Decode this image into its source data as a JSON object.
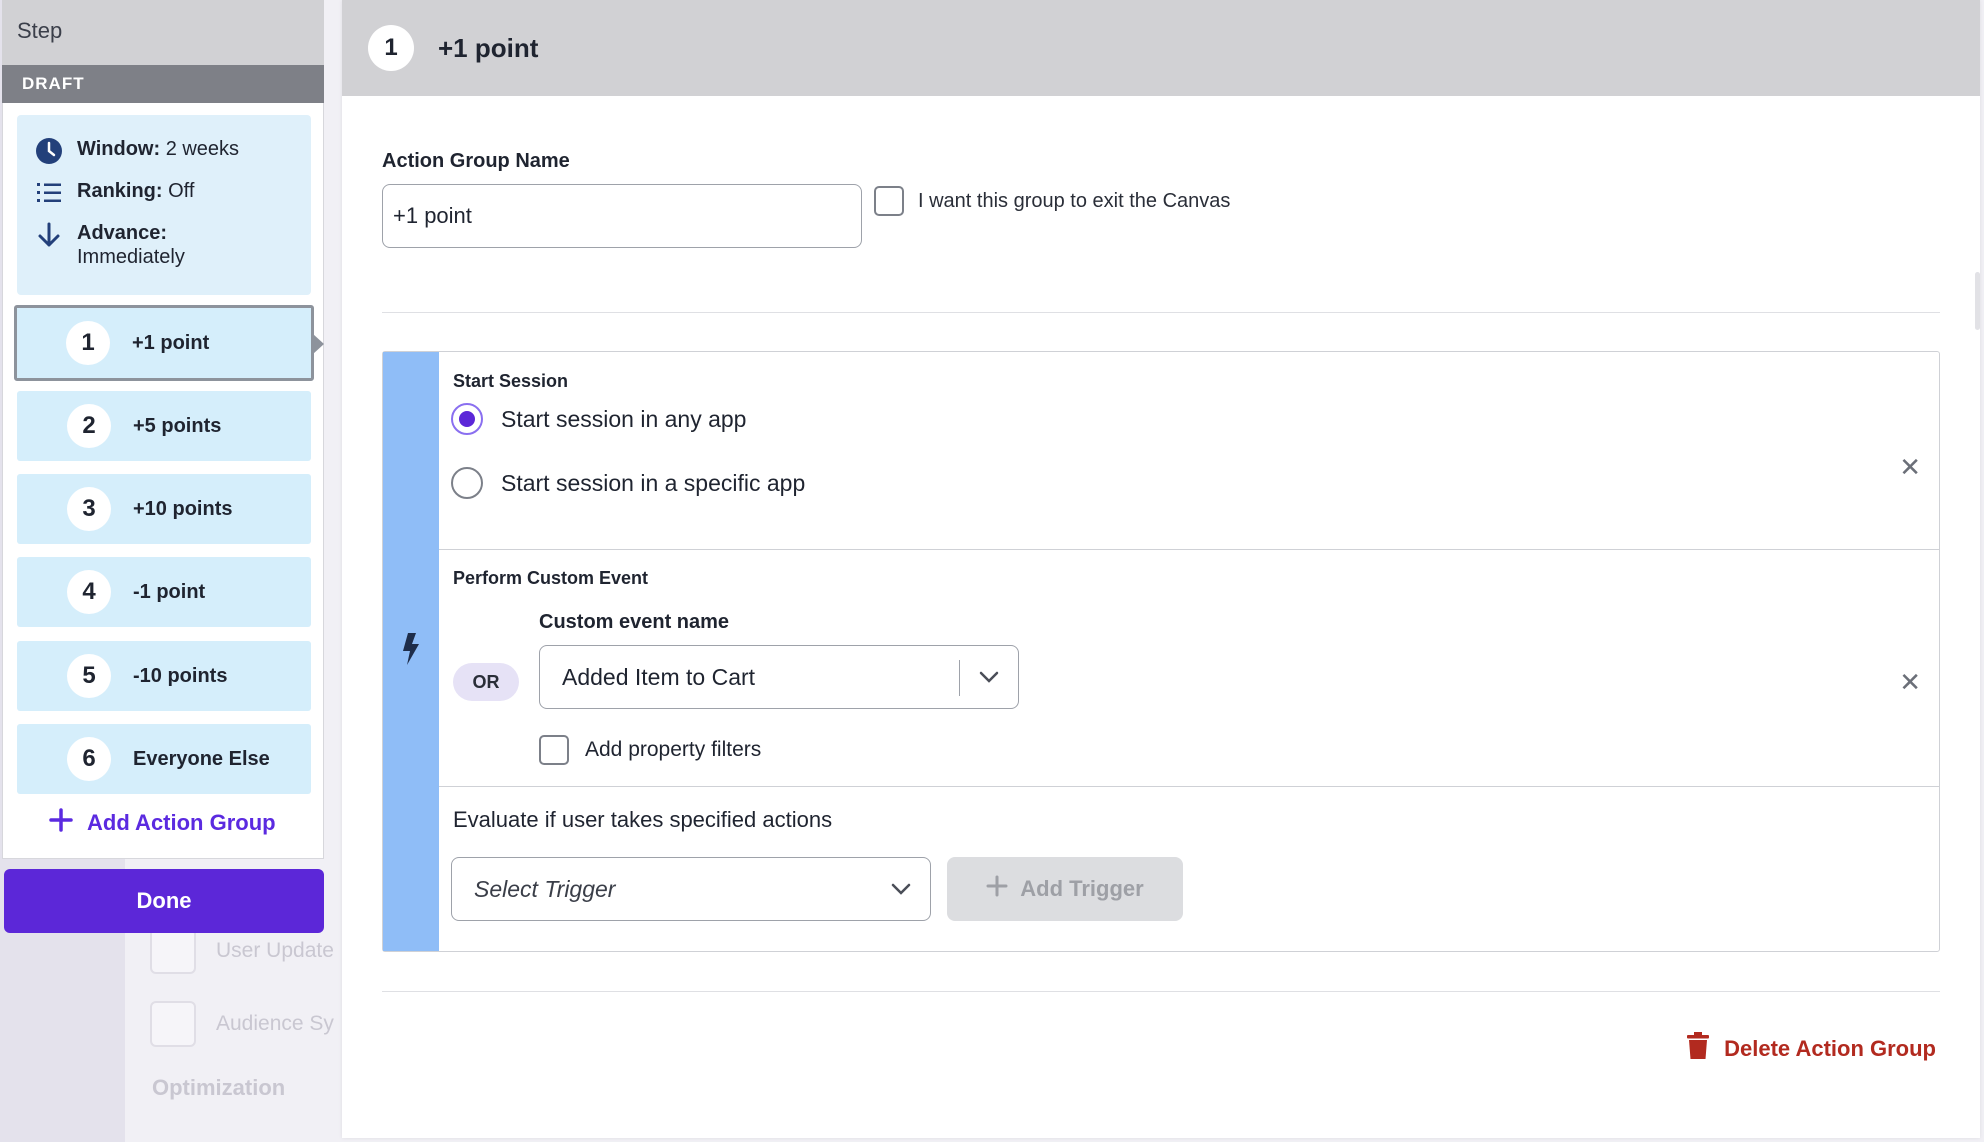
{
  "colors": {
    "accent": "#5c27d8",
    "stripe": "#8fbdf7",
    "group_bg": "#d5eefb",
    "danger": "#b22a1f",
    "header_gray": "#d1d1d4"
  },
  "background": {
    "items": [
      {
        "label": "User Update",
        "icon": "user-update-icon"
      },
      {
        "label": "Audience Sy",
        "icon": "audience-sync-icon"
      }
    ],
    "heading": "Optimization"
  },
  "sidebar": {
    "title": "Step",
    "status": "DRAFT",
    "summary": {
      "window_label": "Window:",
      "window_value": "2 weeks",
      "ranking_label": "Ranking:",
      "ranking_value": "Off",
      "advance_label": "Advance:",
      "advance_value": "Immediately"
    },
    "groups": [
      {
        "number": "1",
        "label": "+1 point"
      },
      {
        "number": "2",
        "label": "+5 points"
      },
      {
        "number": "3",
        "label": "+10 points"
      },
      {
        "number": "4",
        "label": "-1 point"
      },
      {
        "number": "5",
        "label": "-10 points"
      },
      {
        "number": "6",
        "label": "Everyone Else"
      }
    ],
    "add_group_label": "Add Action Group",
    "done_label": "Done"
  },
  "main": {
    "header": {
      "number": "1",
      "title": "+1 point"
    },
    "name_label": "Action Group Name",
    "name_value": "+1 point",
    "exit_label": "I want this group to exit the Canvas",
    "start_session": {
      "title": "Start Session",
      "options": [
        {
          "label": "Start session in any app",
          "selected": true
        },
        {
          "label": "Start session in a specific app",
          "selected": false
        }
      ]
    },
    "custom_event": {
      "title": "Perform Custom Event",
      "or_label": "OR",
      "field_label": "Custom event name",
      "selected_value": "Added Item to Cart",
      "property_filters_label": "Add property filters"
    },
    "evaluate_label": "Evaluate if user takes specified actions",
    "trigger_placeholder": "Select Trigger",
    "add_trigger_label": "Add Trigger",
    "delete_label": "Delete Action Group"
  }
}
